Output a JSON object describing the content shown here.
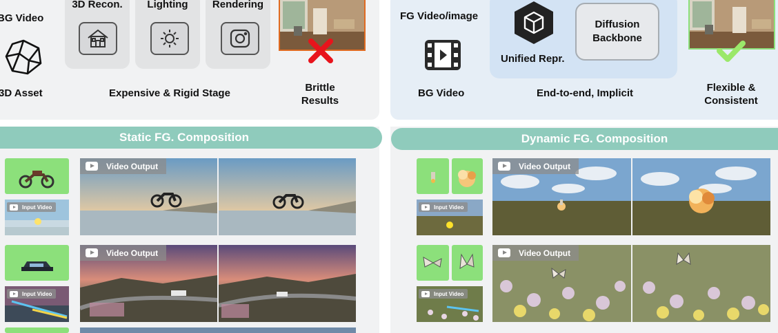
{
  "top_left": {
    "bg_video_label": "BG Video",
    "asset_label": "3D Asset",
    "stages": [
      {
        "label": "3D Recon.",
        "icon": "house-icon"
      },
      {
        "label": "Lighting",
        "icon": "sun-icon"
      },
      {
        "label": "Rendering",
        "icon": "camera-icon"
      }
    ],
    "stage_caption": "Expensive & Rigid Stage",
    "result_label_line1": "Brittle",
    "result_label_line2": "Results",
    "result_mark": "red-x-icon"
  },
  "top_right": {
    "fg_label": "FG Video/image",
    "bg_label": "BG Video",
    "unified_label": "Unified Repr.",
    "backbone_line1": "Diffusion",
    "backbone_line2": "Backbone",
    "caption": "End-to-end, Implicit",
    "result_label_line1": "Flexible &",
    "result_label_line2": "Consistent",
    "result_mark": "green-check-icon"
  },
  "static_section": {
    "title": "Static FG. Composition",
    "rows": [
      {
        "fg_object": "motorcycle",
        "input_label": "Input Video",
        "output_label": "Video Output"
      },
      {
        "fg_object": "car",
        "input_label": "Input Video",
        "output_label": "Video Output"
      }
    ]
  },
  "dynamic_section": {
    "title": "Dynamic FG. Composition",
    "rows": [
      {
        "fg_objects": [
          "rocket",
          "explosion"
        ],
        "input_label": "Input Video",
        "output_label": "Video Output"
      },
      {
        "fg_objects": [
          "butterfly",
          "butterfly"
        ],
        "input_label": "Input Video",
        "output_label": "Video Output"
      }
    ]
  },
  "colors": {
    "banner": "#8fcbbc",
    "green_tile": "#8ce07b",
    "fail": "#e8141c",
    "success": "#9be86a"
  }
}
